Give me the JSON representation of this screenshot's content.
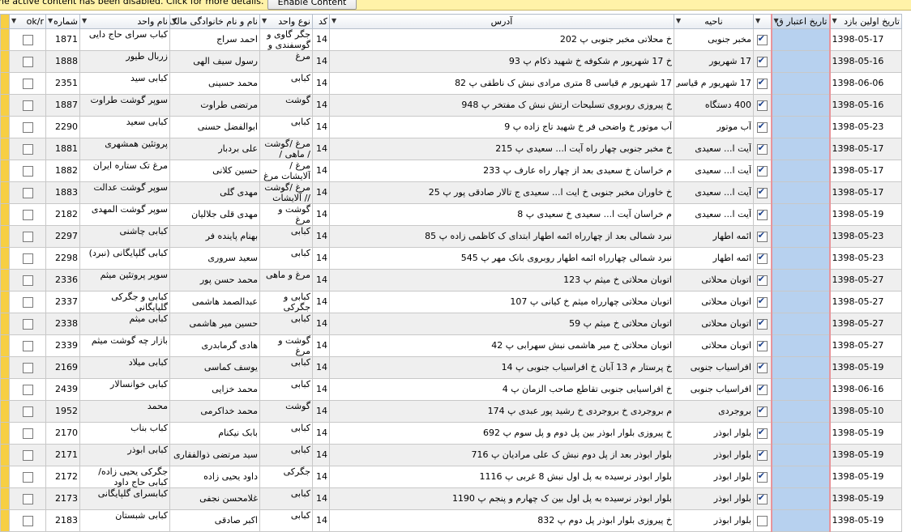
{
  "message_bar": {
    "text": "ne active content has been disabled. Click for more details.",
    "enable_label": "Enable Content"
  },
  "columns": {
    "ok": "ok/r",
    "num": "شماره",
    "unit_name": "نام واحد",
    "owner": "نام و نام خانوادگی مالک",
    "unit_type": "نوع  واحد",
    "code": "کد",
    "address": "آدرس",
    "district": "ناحیه",
    "chk": "",
    "credit_date": "تاریخ اعتبار ق",
    "first_visit": "تاریخ اولین بازد"
  },
  "rows": [
    {
      "ok": false,
      "num": "1871",
      "unit_name": "کباب سرای حاج دایی",
      "owner": "احمد سراج",
      "unit_type": "جگر گاوی و گوسفندی و بیان",
      "code": "14",
      "address": "خ محلاتی مخبر جنوبی پ 202",
      "district": "مخبر جنوبی",
      "chk": true,
      "first_visit": "1398-05-17"
    },
    {
      "ok": false,
      "num": "1888",
      "unit_name": "زربال طیور",
      "owner": "رسول سیف الهی",
      "unit_type": "مرغ",
      "code": "14",
      "address": "خ 17 شهریور م شکوفه خ شهید ذکام پ 93",
      "district": "17 شهریور",
      "chk": true,
      "first_visit": "1398-05-16"
    },
    {
      "ok": false,
      "num": "2351",
      "unit_name": "کبابی سید",
      "owner": "محمد حسینی",
      "unit_type": "کبابی",
      "code": "14",
      "address": "17 شهریور م قیاسی 8 متری مرادی نبش ک ناطقی پ 82",
      "district": "17 شهریور م قیاسی",
      "chk": true,
      "first_visit": "1398-06-06"
    },
    {
      "ok": false,
      "num": "1887",
      "unit_name": "سوپر گوشت طراوت",
      "owner": "مرتضی طراوت",
      "unit_type": "گوشت",
      "code": "14",
      "address": "خ پیروزی روبروی تسلیحات ارتش نبش ک مفتخر پ 948",
      "district": "400 دستگاه",
      "chk": true,
      "first_visit": "1398-05-16"
    },
    {
      "ok": false,
      "num": "2290",
      "unit_name": "کبابی سعید",
      "owner": "ابوالفضل حسنی",
      "unit_type": "کبابی",
      "code": "14",
      "address": "آب موتور خ واضحی فر خ شهید تاج زاده پ 9",
      "district": "آب موتور",
      "chk": true,
      "first_visit": "1398-05-23"
    },
    {
      "ok": false,
      "num": "1881",
      "unit_name": "پروتئین همشهری",
      "owner": "علی بردبار",
      "unit_type": "مرغ /گوشت / ماهی /آلایشات",
      "code": "14",
      "address": "خ مخبر جنوبی چهار راه آیت ا... سعیدی پ 215",
      "district": "آیت ا... سعیدی",
      "chk": true,
      "first_visit": "1398-05-17"
    },
    {
      "ok": false,
      "num": "1882",
      "unit_name": "مرغ تک ستاره ایران",
      "owner": "حسین کلانی",
      "unit_type": "مرغ / آلایشات مرغ",
      "code": "14",
      "address": "م خراسان خ سعیدی بعد از چهار راه عارف پ 233",
      "district": "آیت ا... سعیدی",
      "chk": true,
      "first_visit": "1398-05-17"
    },
    {
      "ok": false,
      "num": "1883",
      "unit_name": "سوپر گوشت عدالت",
      "owner": "مهدی گلی",
      "unit_type": "مرغ /گوشت // آلایشات",
      "code": "14",
      "address": "خ خاوران مخبر جنوبی خ ایت ا... سعیدی ج تالار صادقی پور پ 25",
      "district": "آیت ا... سعیدی",
      "chk": true,
      "first_visit": "1398-05-17"
    },
    {
      "ok": false,
      "num": "2182",
      "unit_name": "سوپر گوشت المهدی",
      "owner": "مهدی قلی جلالیان",
      "unit_type": "گوشت و مرغ",
      "code": "14",
      "address": "م خراسان آیت ا... سعیدی خ سعیدی پ 8",
      "district": "آیت ا... سعیدی",
      "chk": true,
      "first_visit": "1398-05-19"
    },
    {
      "ok": false,
      "num": "2297",
      "unit_name": "کبابی چاشنی",
      "owner": "بهنام پاینده فر",
      "unit_type": "کبابی",
      "code": "14",
      "address": "نبرد شمالی بعد از چهارراه ائمه اطهار ابتدای ک کاظمی زاده پ 85",
      "district": "ائمه اطهار",
      "chk": true,
      "first_visit": "1398-05-23"
    },
    {
      "ok": false,
      "num": "2298",
      "unit_name": "کبابی گلپایگانی (نبرد)",
      "owner": "سعید سروری",
      "unit_type": "کبابی",
      "code": "14",
      "address": "نبرد شمالی چهارراه ائمه اطهار روبروی بانک مهر پ 545",
      "district": "ائمه اطهار",
      "chk": true,
      "first_visit": "1398-05-23"
    },
    {
      "ok": false,
      "num": "2336",
      "unit_name": "سوپر پروتئین میثم",
      "owner": "محمد حسن پور",
      "unit_type": "مرغ و ماهی",
      "code": "14",
      "address": "اتوبان محلاتی خ میثم پ 123",
      "district": "اتوبان محلاتی",
      "chk": true,
      "first_visit": "1398-05-27"
    },
    {
      "ok": false,
      "num": "2337",
      "unit_name": "کبابی و جگرکی گلپایگانی",
      "owner": "عبدالصمد هاشمی",
      "unit_type": "کبابی و جگرکی",
      "code": "14",
      "address": "اتوبان محلاتی چهارراه میثم خ کیانی پ 107",
      "district": "اتوبان محلاتی",
      "chk": true,
      "first_visit": "1398-05-27"
    },
    {
      "ok": false,
      "num": "2338",
      "unit_name": "کبابی میثم",
      "owner": "حسین میر هاشمی",
      "unit_type": "کبابی",
      "code": "14",
      "address": "اتوبان محلاتی خ میثم پ 59",
      "district": "اتوبان محلاتی",
      "chk": true,
      "first_visit": "1398-05-27"
    },
    {
      "ok": false,
      "num": "2339",
      "unit_name": "بازار چه گوشت میثم",
      "owner": "هادی گرمابدری",
      "unit_type": "گوشت و مرغ",
      "code": "14",
      "address": "اتوبان محلاتی خ میر هاشمی نبش سهرابی پ 42",
      "district": "اتوبان محلاتی",
      "chk": true,
      "first_visit": "1398-05-27"
    },
    {
      "ok": false,
      "num": "2169",
      "unit_name": "کبابی میلاد",
      "owner": "یوسف کماسی",
      "unit_type": "کبابی",
      "code": "14",
      "address": "خ پرستار م 13 آبان خ افراسیاب جنوبی پ 14",
      "district": "افراسیاب جنوبی",
      "chk": true,
      "first_visit": "1398-05-19"
    },
    {
      "ok": false,
      "num": "2439",
      "unit_name": "کبابی خوانسالار",
      "owner": "محمد خزایی",
      "unit_type": "کبابی",
      "code": "14",
      "address": "خ افراسیابی جنوبی تقاطع صاحب الزمان پ 4",
      "district": "افراسیاب جنوبی",
      "chk": true,
      "first_visit": "1398-06-16"
    },
    {
      "ok": false,
      "num": "1952",
      "unit_name": "محمد",
      "owner": "محمد خداکرمی",
      "unit_type": "گوشت",
      "code": "14",
      "address": "م بروجردی خ بروجردی خ رشید پور عبدی پ 174",
      "district": "بروجردی",
      "chk": true,
      "first_visit": "1398-05-10"
    },
    {
      "ok": false,
      "num": "2170",
      "unit_name": "کباب بناب",
      "owner": "بابک نیکنام",
      "unit_type": "کبابی",
      "code": "14",
      "address": "خ پیروزی بلوار ابوذر بین پل دوم و پل سوم پ 692",
      "district": "بلوار ابوذر",
      "chk": true,
      "first_visit": "1398-05-19"
    },
    {
      "ok": false,
      "num": "2171",
      "unit_name": "کبابی ابوذر",
      "owner": "سید مرتضی ذوالفقاری",
      "unit_type": "کبابی",
      "code": "14",
      "address": "بلوار ابوذر بعد از پل دوم نبش ک علی مرادیان پ 716",
      "district": "بلوار ابوذر",
      "chk": true,
      "first_visit": "1398-05-19"
    },
    {
      "ok": false,
      "num": "2172",
      "unit_name": "جگرکی یحیی زاده/ کبابی حاج داود",
      "owner": "داود یحیی زاده",
      "unit_type": "جگرکی",
      "code": "14",
      "address": "بلوار ابوذر نرسیده به پل اول نبش 8 غربی پ 1116",
      "district": "بلوار ابوذر",
      "chk": true,
      "first_visit": "1398-05-19"
    },
    {
      "ok": false,
      "num": "2173",
      "unit_name": "کبابسرای گلپایگانی",
      "owner": "غلامحسن نجفی",
      "unit_type": "کبابی",
      "code": "14",
      "address": "بلوار ابوذر نرسیده به پل اول بین ک چهارم و پنجم پ 1190",
      "district": "بلوار ابوذر",
      "chk": true,
      "first_visit": "1398-05-19"
    },
    {
      "ok": false,
      "num": "2183",
      "unit_name": "کبابی شبستان",
      "owner": "اکبر صادقی",
      "unit_type": "کبابی",
      "code": "14",
      "address": "خ پیروزی بلوار ابوذر پل دوم پ 832",
      "district": "بلوار ابوذر",
      "chk": false,
      "first_visit": "1398-05-19"
    }
  ]
}
